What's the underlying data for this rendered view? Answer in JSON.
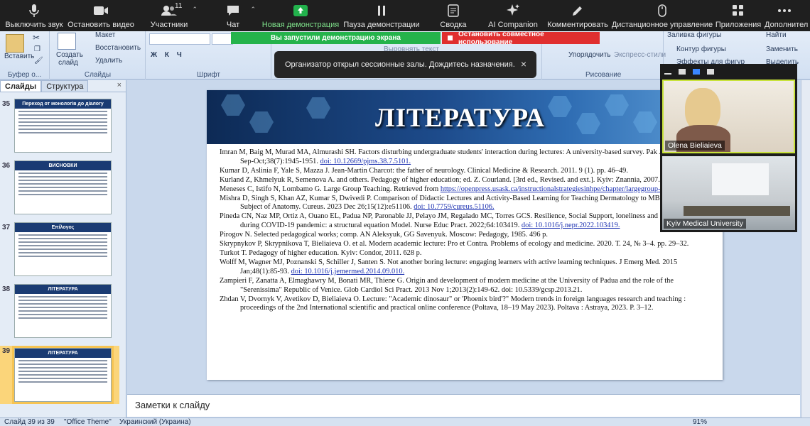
{
  "zoom_toolbar": {
    "mute": "Выключить звук",
    "stop_video": "Остановить видео",
    "participants": "Участники",
    "participants_count": "11",
    "chat": "Чат",
    "new_share": "Новая демонстрация",
    "pause_share": "Пауза демонстрации",
    "summary": "Сводка",
    "ai_companion": "AI Companion",
    "comments": "Комментировать",
    "remote_control": "Дистанционное управление",
    "apps": "Приложения",
    "more": "Дополнител"
  },
  "share_banner": {
    "status": "Вы запустили демонстрацию экрана",
    "stop": "Остановить совместное использование"
  },
  "toast": {
    "message": "Организатор открыл сессионные залы. Дождитесь назначения.",
    "close": "×"
  },
  "ribbon": {
    "paste": "Вставить",
    "clipboard_group": "Буфер о...",
    "create_slide": "Создать слайд",
    "layout": "Макет",
    "reset": "Восстановить",
    "delete": "Удалить",
    "slides_group": "Слайды",
    "font_group": "Шрифт",
    "align_text": "Выровнять текст",
    "arrange": "Упорядочить",
    "quick_styles": "Экспресс-стили",
    "fill": "Заливка фигуры",
    "outline": "Контур фигуры",
    "effects": "Эффекты для фигур",
    "drawing_group": "Рисование",
    "find": "Найти",
    "replace": "Заменить",
    "select": "Выделить"
  },
  "left_pane": {
    "tab_slides": "Слайды",
    "tab_outline": "Структура",
    "close": "×",
    "thumbnails": [
      {
        "num": "35",
        "title": "Переход от монологів до діалогу"
      },
      {
        "num": "36",
        "title": "ВИСНОВКИ"
      },
      {
        "num": "37",
        "title": "Επίλογος"
      },
      {
        "num": "38",
        "title": "ЛІТЕРАТУРА"
      },
      {
        "num": "39",
        "title": "ЛІТЕРАТУРА"
      }
    ]
  },
  "slide": {
    "title": "ЛІТЕРАТУРА",
    "references": [
      {
        "text": "Imran M, Baig M, Murad MA, Almurashi SH. Factors disturbing undergraduate students' interaction during lectures: A university-based survey. Pak J Med Sci. 2022 Sep-Oct;38(7):1945-1951. ",
        "link": "doi: 10.12669/pjms.38.7.5101."
      },
      {
        "text": "Kumar D, Aslinia F, Yale S, Mazza J. Jean-Martin Charcot: the father of neurology. Clinical Medicine & Research. 2011. 9 (1). pp. 46–49.",
        "link": ""
      },
      {
        "text": "Kurland Z, Khmelyuk R, Semenova A. and others. Pedagogy of higher education; ed. Z. Courland. [3rd ed., Revised. and ext.]. Kyiv: Znannia, 2007. 495 p.",
        "link": ""
      },
      {
        "text": "Meneses C, Istifo N, Lombamo G. Large Group Teaching. Retrieved from ",
        "link": "https://openpress.usask.ca/instructionalstrategiesinhpe/chapter/largegroup-teaching"
      },
      {
        "text": "Mishra D, Singh S, Khan AZ, Kumar S, Dwivedi P. Comparison of Didactic Lectures and Activity-Based Learning for Teaching Dermatology to MBBS Students in the Subject of Anatomy. Cureus. 2023 Dec 26;15(12):e51106. ",
        "link": "doi: 10.7759/cureus.51106."
      },
      {
        "text": "Pineda CN, Naz MP, Ortiz A, Ouano EL, Padua NP, Paronable JJ, Pelayo JM, Regalado MC, Torres GCS. Resilience, Social Support, loneliness and quality of life during COVID-19 pandemic: a structural equation Model. Nurse Educ Pract. 2022;64:103419. ",
        "link": "doi: 10.1016/j.nepr.2022.103419."
      },
      {
        "text": "Pirogov N. Selected pedagogical works; comp. AN Aleksyuk, GG Savenyuk. Moscow: Pedagogy, 1985. 496 p.",
        "link": ""
      },
      {
        "text": "Skrypnykov P, Skrypnikova T, Bieliaieva O. et al. Modern academic lecture: Pro et Contra. Problems of ecology and medicine. 2020. Т. 24, № 3–4. pp. 29–32.",
        "link": ""
      },
      {
        "text": "Turkot T. Pedagogy of higher education. Kyiv: Condor, 2011. 628 p.",
        "link": ""
      },
      {
        "text": "Wolff M, Wagner MJ, Poznanski S, Schiller J, Santen S. Not another boring lecture: engaging learners with active learning techniques. J Emerg Med. 2015 Jan;48(1):85-93. ",
        "link": "doi: 10.1016/j.jemermed.2014.09.010."
      },
      {
        "text": "Zampieri F, Zanatta A, Elmaghawry M, Bonati MR, Thiene G. Origin and development of modern medicine at the University of Padua and the role of the \"Serenissima\" Republic of Venice. Glob Cardiol Sci Pract. 2013 Nov 1;2013(2):149-62. doi: 10.5339/gcsp.2013.21.",
        "link": ""
      },
      {
        "text": "Zhdan V, Dvornyk V, Avetikov D, Bieliaieva O. Lecture: \"Academic dinosaur\" or 'Phoenix bird'?\" Modern trends in foreign languages research and teaching : proceedings of the 2nd International scientific and practical online conference (Poltava, 18–19 May 2023). Poltava : Astraya, 2023. P. 3–12.",
        "link": ""
      }
    ]
  },
  "notes": {
    "placeholder": "Заметки к слайду"
  },
  "video_panel": {
    "participant1": "Olena Bieliaieva",
    "participant2": "Kyiv Medical University"
  },
  "status_bar": {
    "slide_info": "Слайд 39 из 39",
    "theme": "\"Office Theme\"",
    "language": "Украинский (Украина)",
    "zoom": "91%"
  },
  "colors": {
    "share_green": "#25b34b",
    "share_red": "#e02f2f",
    "banner_dark": "#0d2a55",
    "link_blue": "#1a2fb0"
  }
}
